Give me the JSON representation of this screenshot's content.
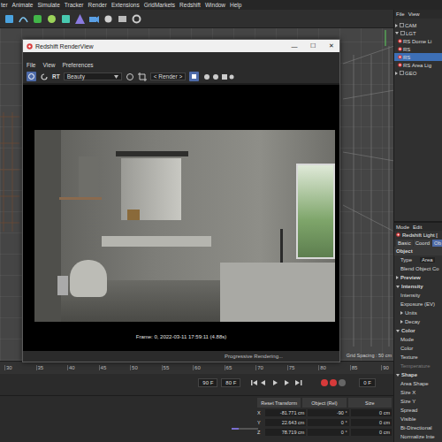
{
  "menu": [
    "ter",
    "Animate",
    "Simulate",
    "Tracker",
    "Render",
    "Extensions",
    "GridMarkets",
    "Redshift",
    "Window",
    "Help"
  ],
  "object_manager": {
    "menu": [
      "File",
      "View"
    ],
    "items": [
      {
        "label": "CAM",
        "expanded": false,
        "selected": false
      },
      {
        "label": "LGT",
        "expanded": true,
        "selected": false,
        "children": [
          {
            "label": "RS Dome Li",
            "selected": false
          },
          {
            "label": "RS",
            "selected": false
          },
          {
            "label": "RS",
            "selected": true
          },
          {
            "label": "RS Area Lig",
            "selected": false
          }
        ]
      },
      {
        "label": "GEO",
        "expanded": false,
        "selected": false
      }
    ]
  },
  "render_view": {
    "title": "Redshift RenderView",
    "window_controls": [
      "—",
      "☐",
      "✕"
    ],
    "menu": [
      "File",
      "View",
      "Preferences"
    ],
    "toolbar": {
      "rt": "RT",
      "aov": "Beauty",
      "camera": "< Render >"
    },
    "caption": "Frame: 0, 2022-03-11 17:59:11 (4.88s)",
    "status": "Progressive Rendering..."
  },
  "viewport": {
    "grid_spacing": "Grid Spacing : 50 cm"
  },
  "attributes": {
    "menu": [
      "Mode",
      "Edit"
    ],
    "title": "Redshift Light [",
    "tabs": [
      {
        "label": "Basic",
        "selected": false
      },
      {
        "label": "Coord",
        "selected": false
      },
      {
        "label": "Ob",
        "selected": true
      }
    ],
    "rows": [
      {
        "kind": "heading",
        "label": "Object",
        "disabled": false
      },
      {
        "kind": "field",
        "label": "Type",
        "value": "Area",
        "disabled": false
      },
      {
        "kind": "field",
        "label": "Blend Object Co",
        "disabled": false
      },
      {
        "kind": "section",
        "label": "Preview",
        "expanded": false,
        "disabled": false
      },
      {
        "kind": "section",
        "label": "Intensity",
        "expanded": true,
        "disabled": false
      },
      {
        "kind": "field",
        "label": "Intensity",
        "disabled": false
      },
      {
        "kind": "field",
        "label": "Exposure (EV)",
        "disabled": false
      },
      {
        "kind": "group",
        "label": "Units",
        "expanded": false,
        "disabled": false
      },
      {
        "kind": "group",
        "label": "Decay",
        "expanded": false,
        "disabled": false
      },
      {
        "kind": "section",
        "label": "Color",
        "expanded": true,
        "disabled": false
      },
      {
        "kind": "field",
        "label": "Mode",
        "disabled": false
      },
      {
        "kind": "field",
        "label": "Color",
        "disabled": false
      },
      {
        "kind": "field",
        "label": "Texture",
        "disabled": false
      },
      {
        "kind": "field",
        "label": "Temperature",
        "disabled": true
      },
      {
        "kind": "section",
        "label": "Shape",
        "expanded": true,
        "disabled": false
      },
      {
        "kind": "field",
        "label": "Area Shape",
        "disabled": false
      },
      {
        "kind": "field",
        "label": "Size X",
        "disabled": false
      },
      {
        "kind": "field",
        "label": "Size Y",
        "disabled": false
      },
      {
        "kind": "field",
        "label": "Spread",
        "disabled": false
      },
      {
        "kind": "field",
        "label": "Visible",
        "disabled": false
      },
      {
        "kind": "field",
        "label": "Bi-Directional",
        "disabled": false
      },
      {
        "kind": "field",
        "label": "Normalize Inte",
        "disabled": false
      }
    ]
  },
  "timeline": {
    "ticks": [
      "30",
      "35",
      "40",
      "45",
      "50",
      "55",
      "60",
      "65",
      "70",
      "75",
      "80",
      "85",
      "90"
    ],
    "range_fields": [
      "90 F",
      "80 F"
    ],
    "current": "0 F"
  },
  "coordinates": {
    "buttons": [
      "Reset Transform",
      "Object (Rel)",
      "Size"
    ],
    "rows": [
      {
        "axis": "X",
        "position": "-81.771 cm",
        "rotation": "-90 °",
        "size": "0 cm"
      },
      {
        "axis": "Y",
        "position": "22.643 cm",
        "rotation": "0 °",
        "size": "0 cm"
      },
      {
        "axis": "Z",
        "position": "78.719 cm",
        "rotation": "0 °",
        "size": "0 cm"
      }
    ]
  }
}
